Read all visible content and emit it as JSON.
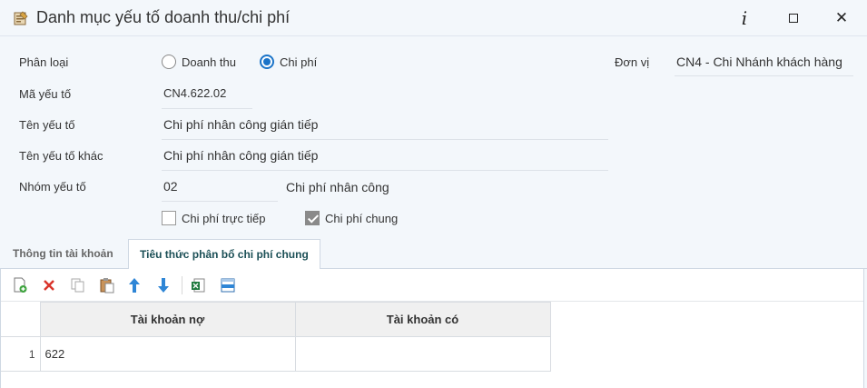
{
  "window": {
    "title": "Danh mục yếu tố doanh thu/chi phí"
  },
  "form": {
    "phan_loai": {
      "label": "Phân loại",
      "options": [
        {
          "label": "Doanh thu",
          "selected": false
        },
        {
          "label": "Chi phí",
          "selected": true
        }
      ]
    },
    "don_vi": {
      "label": "Đơn vị",
      "value": "CN4 - Chi Nhánh khách hàng"
    },
    "ma_yeu_to": {
      "label": "Mã yếu tố",
      "value": "CN4.622.02"
    },
    "ten_yeu_to": {
      "label": "Tên yếu tố",
      "value": "Chi phí nhân công gián tiếp"
    },
    "ten_yeu_to_khac": {
      "label": "Tên yếu tố khác",
      "value": "Chi phí nhân công gián tiếp"
    },
    "nhom_yeu_to": {
      "label": "Nhóm yếu tố",
      "code": "02",
      "name": "Chi phí nhân công"
    },
    "checks": [
      {
        "label": "Chi phí trực tiếp",
        "checked": false
      },
      {
        "label": "Chi phí chung",
        "checked": true
      }
    ]
  },
  "tabs": [
    {
      "label": "Thông tin tài khoản",
      "active": false
    },
    {
      "label": "Tiêu thức phân bổ chi phí chung",
      "active": true
    }
  ],
  "toolbar": {
    "icons": [
      "add-row-icon",
      "delete-icon",
      "copy-icon",
      "paste-icon",
      "move-up-icon",
      "move-down-icon",
      "excel-export-icon",
      "layout-icon"
    ]
  },
  "grid": {
    "columns": [
      "Tài khoản nợ",
      "Tài khoản có"
    ],
    "rows": [
      {
        "num": "1",
        "cells": [
          "622",
          ""
        ]
      }
    ]
  },
  "colors": {
    "accent": "#1a73c8",
    "background": "#f3f7fb",
    "active_tab_text": "#1b4f56"
  }
}
